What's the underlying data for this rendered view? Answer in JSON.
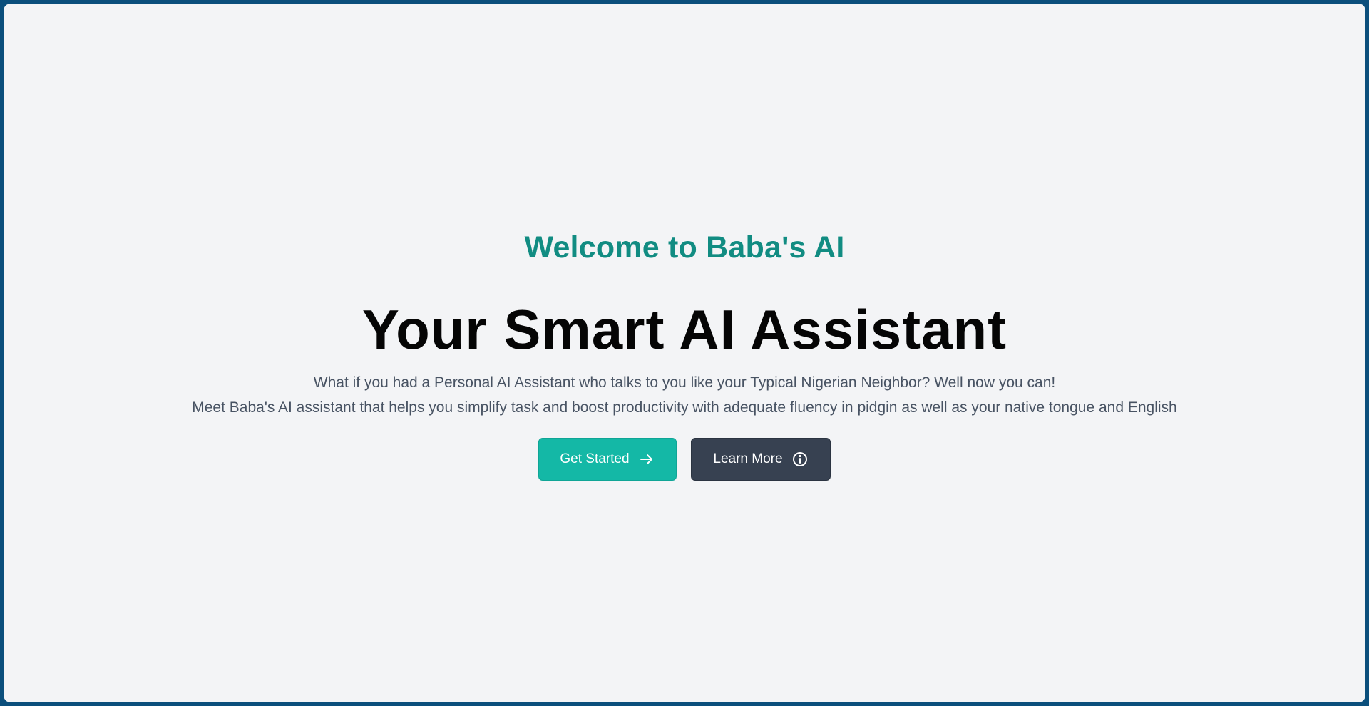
{
  "hero": {
    "eyebrow": "Welcome to Baba's AI",
    "headline": "Your Smart AI Assistant",
    "description_lines": [
      "What if you had a Personal AI Assistant who talks to you like your Typical Nigerian Neighbor? Well now you can!",
      "Meet Baba's AI assistant that helps you simplify task and boost productivity with adequate fluency in pidgin as well as your native tongue and English"
    ]
  },
  "actions": {
    "primary": {
      "label": "Get Started",
      "icon": "arrow-right-icon"
    },
    "secondary": {
      "label": "Learn More",
      "icon": "info-circle-icon"
    }
  },
  "colors": {
    "page_background": "#f3f4f6",
    "frame_border": "#0b4f7c",
    "accent": "#14b8a6",
    "eyebrow_text": "#118c82",
    "secondary_button": "#374151"
  }
}
